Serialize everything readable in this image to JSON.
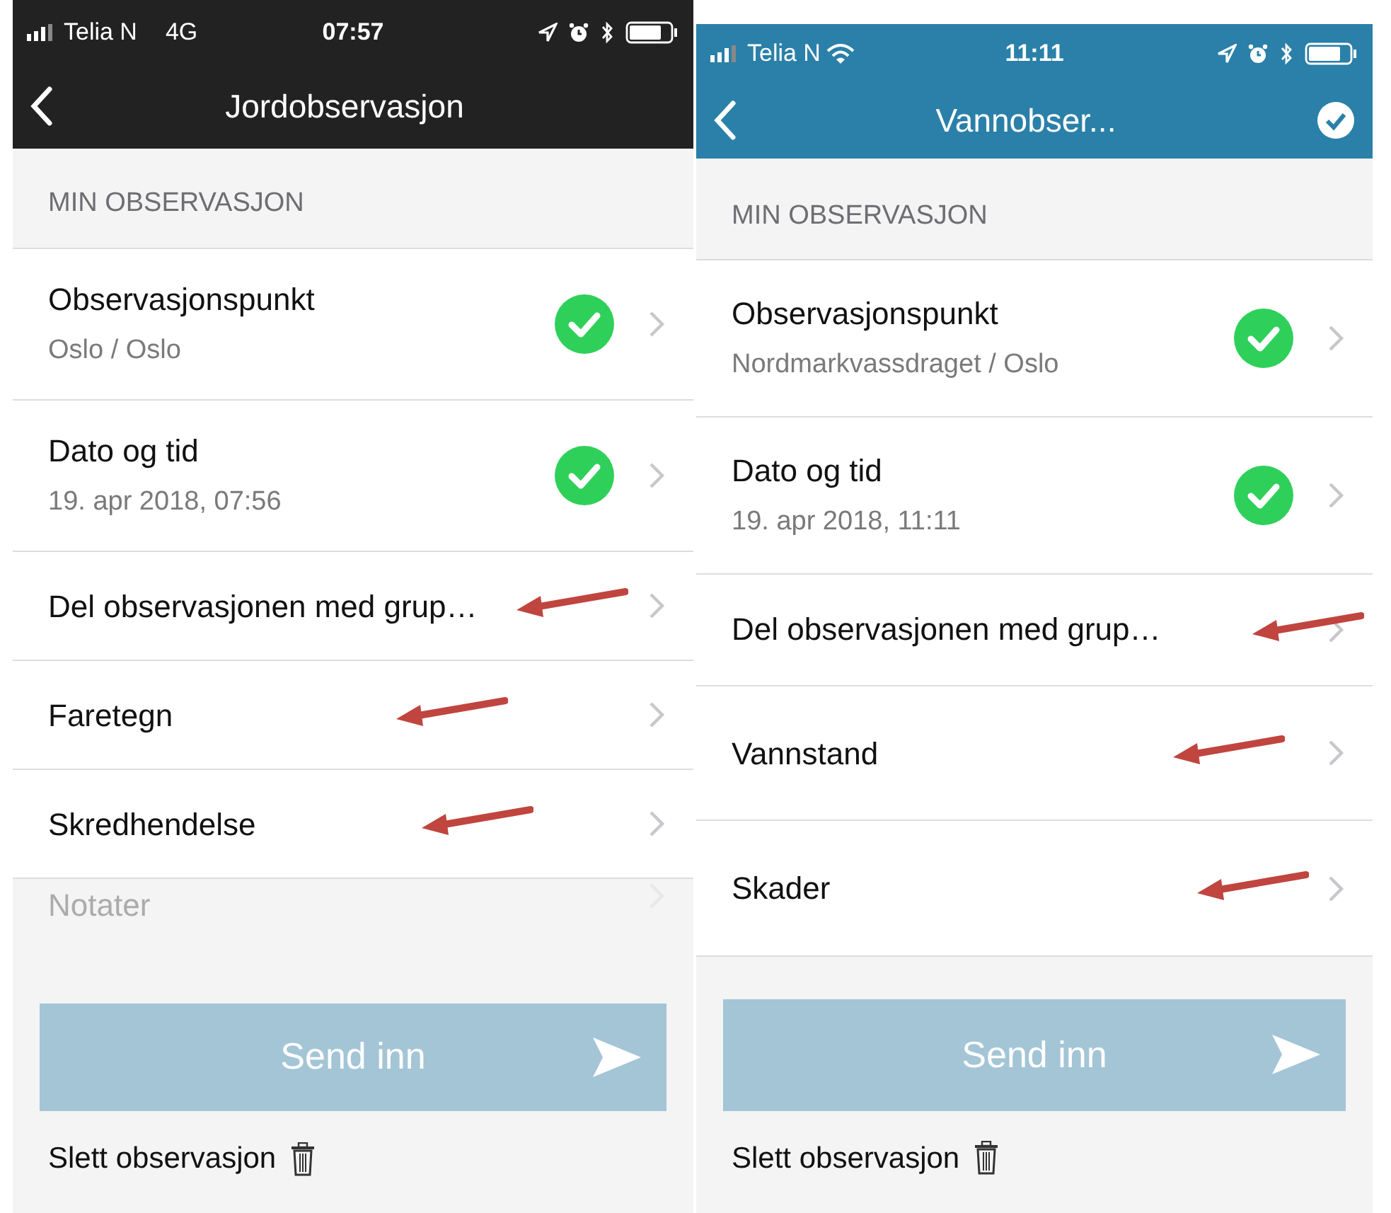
{
  "screens": [
    {
      "color": "#222222",
      "status_bar": {
        "carrier": "Telia N",
        "network": "4G",
        "wifi": false,
        "time": "07:57"
      },
      "nav": {
        "title": "Jordobservasjon",
        "confirm_button": false
      },
      "section_header": "MIN OBSERVASJON",
      "rows": [
        {
          "title": "Observasjonspunkt",
          "subtitle": "Oslo / Oslo",
          "done": true,
          "arrow": false,
          "faded": false
        },
        {
          "title": "Dato og tid",
          "subtitle": "19. apr 2018, 07:56",
          "done": true,
          "arrow": false,
          "faded": false
        },
        {
          "title": "Del observasjonen med grup…",
          "done": false,
          "arrow": true,
          "faded": false
        },
        {
          "title": "Faretegn",
          "done": false,
          "arrow": true,
          "faded": false
        },
        {
          "title": "Skredhendelse",
          "done": false,
          "arrow": true,
          "faded": false
        },
        {
          "title": "Notater",
          "done": false,
          "arrow": false,
          "faded": true
        }
      ],
      "submit_button": "Send inn",
      "delete_link": "Slett observasjon"
    },
    {
      "color": "#2a80a8",
      "status_bar": {
        "carrier": "Telia N",
        "wifi": true,
        "time": "11:11"
      },
      "nav": {
        "title": "Vannobser...",
        "confirm_button": true
      },
      "section_header": "MIN OBSERVASJON",
      "rows": [
        {
          "title": "Observasjonspunkt",
          "subtitle": "Nordmarkvassdraget / Oslo",
          "done": true,
          "arrow": false,
          "faded": false
        },
        {
          "title": "Dato og tid",
          "subtitle": "19. apr 2018, 11:11",
          "done": true,
          "arrow": false,
          "faded": false
        },
        {
          "title": "Del observasjonen med grup…",
          "done": false,
          "arrow": true,
          "faded": false
        },
        {
          "title": "Vannstand",
          "done": false,
          "arrow": true,
          "faded": false
        },
        {
          "title": "Skader",
          "done": false,
          "arrow": true,
          "faded": false
        }
      ],
      "submit_button": "Send inn",
      "delete_link": "Slett observasjon"
    }
  ]
}
